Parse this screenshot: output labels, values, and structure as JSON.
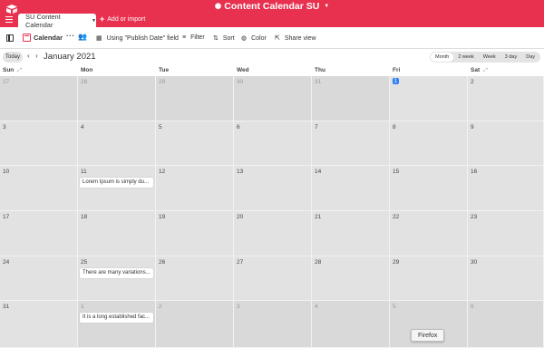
{
  "header": {
    "base_title": "Content Calendar SU",
    "brand_color": "#e8304f",
    "active_tab": "SU Content Calendar",
    "add_import": "Add or import"
  },
  "toolbar": {
    "view_name": "Calendar",
    "date_field": "Using \"Publish Date\" field",
    "filter": "Filter",
    "sort": "Sort",
    "color": "Color",
    "share": "Share view"
  },
  "nav": {
    "today": "Today",
    "month": "January 2021",
    "modes": [
      "Month",
      "2 week",
      "Week",
      "3 day",
      "Day"
    ],
    "active_mode": "Month"
  },
  "weekdays": [
    "Sun",
    "Mon",
    "Tue",
    "Wed",
    "Thu",
    "Fri",
    "Sat"
  ],
  "weeks": [
    [
      {
        "d": "27",
        "out": true
      },
      {
        "d": "28",
        "out": true
      },
      {
        "d": "29",
        "out": true
      },
      {
        "d": "30",
        "out": true
      },
      {
        "d": "31",
        "out": true
      },
      {
        "d": "1",
        "highlight": true
      },
      {
        "d": "2"
      }
    ],
    [
      {
        "d": "3"
      },
      {
        "d": "4"
      },
      {
        "d": "5"
      },
      {
        "d": "6"
      },
      {
        "d": "7"
      },
      {
        "d": "8"
      },
      {
        "d": "9"
      }
    ],
    [
      {
        "d": "10"
      },
      {
        "d": "11",
        "event": "Lorem Ipsum is simply du..."
      },
      {
        "d": "12"
      },
      {
        "d": "13"
      },
      {
        "d": "14"
      },
      {
        "d": "15"
      },
      {
        "d": "16"
      }
    ],
    [
      {
        "d": "17"
      },
      {
        "d": "18"
      },
      {
        "d": "19"
      },
      {
        "d": "20"
      },
      {
        "d": "21"
      },
      {
        "d": "22"
      },
      {
        "d": "23"
      }
    ],
    [
      {
        "d": "24"
      },
      {
        "d": "25",
        "event": "There are many variations..."
      },
      {
        "d": "26"
      },
      {
        "d": "27"
      },
      {
        "d": "28"
      },
      {
        "d": "29"
      },
      {
        "d": "30"
      }
    ],
    [
      {
        "d": "31"
      },
      {
        "d": "1",
        "out": true,
        "event": "It is a long established fac..."
      },
      {
        "d": "2",
        "out": true
      },
      {
        "d": "3",
        "out": true
      },
      {
        "d": "4",
        "out": true
      },
      {
        "d": "5",
        "out": true
      },
      {
        "d": "6",
        "out": true
      }
    ]
  ],
  "tooltip": "Firefox"
}
